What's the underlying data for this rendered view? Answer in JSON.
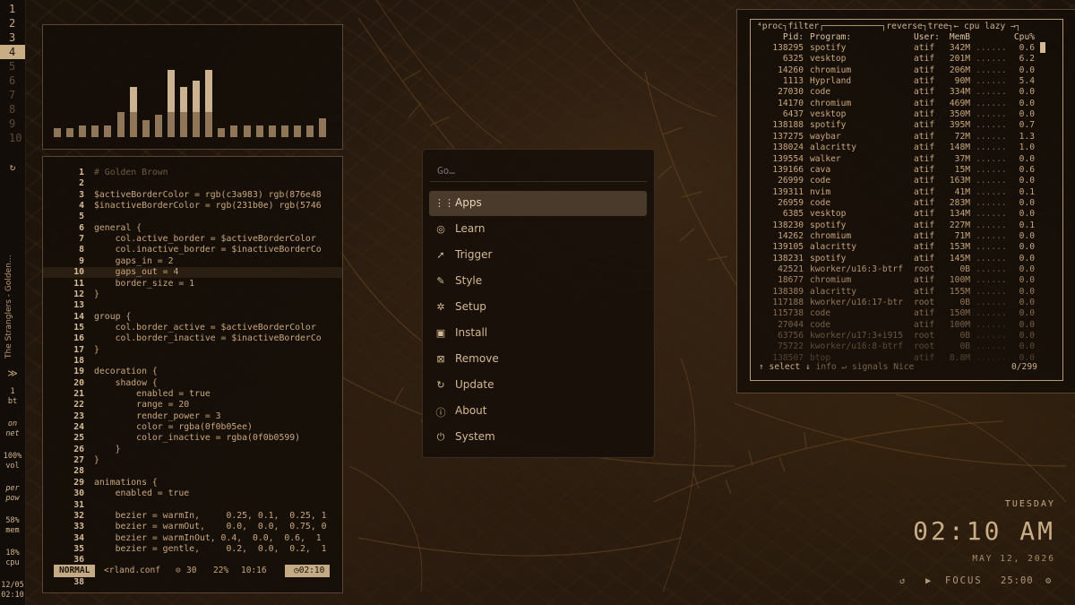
{
  "workspaces": [
    "1",
    "2",
    "3",
    "4",
    "5",
    "6",
    "7",
    "8",
    "9",
    "10"
  ],
  "active_workspace": "4",
  "sidebar": {
    "now_playing": "The Stranglers - Golden…",
    "bluetooth": "1\nbt",
    "network": "on\nnet",
    "volume": "100%\nvol",
    "power": "per\npow",
    "memory": "58%\nmem",
    "cpu": "18%\ncpu",
    "date": "12/05",
    "time": "02:10"
  },
  "visualizer": {
    "levels": [
      0.08,
      0.08,
      0.1,
      0.1,
      0.1,
      0.22,
      0.45,
      0.15,
      0.2,
      0.6,
      0.45,
      0.5,
      0.6,
      0.05,
      0.1,
      0.1,
      0.1,
      0.1,
      0.1,
      0.1,
      0.1,
      0.17
    ]
  },
  "editor": {
    "lines": [
      {
        "n": "1",
        "t": "# Golden Brown",
        "cmt": true
      },
      {
        "n": "2",
        "t": ""
      },
      {
        "n": "3",
        "t": "$activeBorderColor = rgb(c3a983) rgb(876e48"
      },
      {
        "n": "4",
        "t": "$inactiveBorderColor = rgb(231b0e) rgb(5746"
      },
      {
        "n": "5",
        "t": ""
      },
      {
        "n": "6",
        "t": "general {"
      },
      {
        "n": "7",
        "t": "    col.active_border = $activeBorderColor"
      },
      {
        "n": "8",
        "t": "    col.inactive_border = $inactiveBorderCo"
      },
      {
        "n": "9",
        "t": "    gaps_in = 2"
      },
      {
        "n": "10",
        "t": "    gaps_out = 4",
        "current": true
      },
      {
        "n": "11",
        "t": "    border_size = 1"
      },
      {
        "n": "12",
        "t": "}"
      },
      {
        "n": "13",
        "t": ""
      },
      {
        "n": "14",
        "t": "group {"
      },
      {
        "n": "15",
        "t": "    col.border_active = $activeBorderColor"
      },
      {
        "n": "16",
        "t": "    col.border_inactive = $inactiveBorderCo"
      },
      {
        "n": "17",
        "t": "}"
      },
      {
        "n": "18",
        "t": ""
      },
      {
        "n": "19",
        "t": "decoration {"
      },
      {
        "n": "20",
        "t": "    shadow {"
      },
      {
        "n": "21",
        "t": "        enabled = true"
      },
      {
        "n": "22",
        "t": "        range = 20"
      },
      {
        "n": "23",
        "t": "        render_power = 3"
      },
      {
        "n": "24",
        "t": "        color = rgba(0f0b05ee)"
      },
      {
        "n": "25",
        "t": "        color_inactive = rgba(0f0b0599)"
      },
      {
        "n": "26",
        "t": "    }"
      },
      {
        "n": "27",
        "t": "}"
      },
      {
        "n": "28",
        "t": ""
      },
      {
        "n": "29",
        "t": "animations {"
      },
      {
        "n": "30",
        "t": "    enabled = true"
      },
      {
        "n": "31",
        "t": ""
      },
      {
        "n": "32",
        "t": "    bezier = warmIn,     0.25, 0.1,  0.25, 1"
      },
      {
        "n": "33",
        "t": "    bezier = warmOut,    0.0,  0.0,  0.75, 0"
      },
      {
        "n": "34",
        "t": "    bezier = warmInOut, 0.4,  0.0,  0.6,  1"
      },
      {
        "n": "35",
        "t": "    bezier = gentle,     0.2,  0.0,  0.2,  1"
      },
      {
        "n": "36",
        "t": ""
      },
      {
        "n": "37",
        "t": ""
      },
      {
        "n": "38",
        "t": ""
      }
    ],
    "status": {
      "mode": "NORMAL",
      "file": "<rland.conf",
      "count": "30",
      "percent": "22%",
      "position": "10:16",
      "time": "02:10"
    }
  },
  "launcher": {
    "placeholder": "Go…",
    "items": [
      {
        "icon": "⋮⋮",
        "label": "Apps",
        "selected": true,
        "name": "apps"
      },
      {
        "icon": "◎",
        "label": "Learn",
        "name": "learn"
      },
      {
        "icon": "➚",
        "label": "Trigger",
        "name": "trigger"
      },
      {
        "icon": "✎",
        "label": "Style",
        "name": "style"
      },
      {
        "icon": "✲",
        "label": "Setup",
        "name": "setup"
      },
      {
        "icon": "▣",
        "label": "Install",
        "name": "install"
      },
      {
        "icon": "⊠",
        "label": "Remove",
        "name": "remove"
      },
      {
        "icon": "↻",
        "label": "Update",
        "name": "update"
      },
      {
        "icon": "ⓘ",
        "label": "About",
        "name": "about"
      },
      {
        "icon": "⏻",
        "label": "System",
        "name": "system"
      }
    ]
  },
  "btop": {
    "header": "⁴proc┐filter┌───────────┐reverse┐tree┐← cpu lazy →┐",
    "columns": {
      "pid": "Pid:",
      "program": "Program:",
      "user": "User:",
      "mem": "MemB",
      "cpu": "Cpu%"
    },
    "processes": [
      [
        "138295",
        "spotify",
        "atif",
        "342M",
        "0.6"
      ],
      [
        "6325",
        "vesktop",
        "atif",
        "201M",
        "6.2"
      ],
      [
        "14260",
        "chromium",
        "atif",
        "206M",
        "0.0"
      ],
      [
        "1113",
        "Hyprland",
        "atif",
        "90M",
        "5.4"
      ],
      [
        "27030",
        "code",
        "atif",
        "334M",
        "0.0"
      ],
      [
        "14170",
        "chromium",
        "atif",
        "469M",
        "0.0"
      ],
      [
        "6437",
        "vesktop",
        "atif",
        "350M",
        "0.0"
      ],
      [
        "138188",
        "spotify",
        "atif",
        "395M",
        "0.7"
      ],
      [
        "137275",
        "waybar",
        "atif",
        "72M",
        "1.3"
      ],
      [
        "138024",
        "alacritty",
        "atif",
        "148M",
        "1.0"
      ],
      [
        "139554",
        "walker",
        "atif",
        "37M",
        "0.0"
      ],
      [
        "139166",
        "cava",
        "atif",
        "15M",
        "0.6"
      ],
      [
        "26999",
        "code",
        "atif",
        "163M",
        "0.0"
      ],
      [
        "139311",
        "nvim",
        "atif",
        "41M",
        "0.1"
      ],
      [
        "26959",
        "code",
        "atif",
        "283M",
        "0.0"
      ],
      [
        "6385",
        "vesktop",
        "atif",
        "134M",
        "0.0"
      ],
      [
        "138230",
        "spotify",
        "atif",
        "227M",
        "0.1"
      ],
      [
        "14262",
        "chromium",
        "atif",
        "71M",
        "0.0"
      ],
      [
        "139105",
        "alacritty",
        "atif",
        "153M",
        "0.0"
      ],
      [
        "138231",
        "spotify",
        "atif",
        "145M",
        "0.0"
      ],
      [
        "42521",
        "kworker/u16:3-btrf",
        "root",
        "0B",
        "0.0"
      ],
      [
        "18677",
        "chromium",
        "atif",
        "100M",
        "0.0"
      ],
      [
        "138389",
        "alacritty",
        "atif",
        "155M",
        "0.0"
      ],
      [
        "117188",
        "kworker/u16:17-btr",
        "root",
        "0B",
        "0.0"
      ],
      [
        "115738",
        "code",
        "atif",
        "150M",
        "0.0"
      ],
      [
        "27044",
        "code",
        "atif",
        "100M",
        "0.0"
      ],
      [
        "63756",
        "kworker/u17:3+i915",
        "root",
        "0B",
        "0.0"
      ],
      [
        "75722",
        "kworker/u16:8-btrf",
        "root",
        "0B",
        "0.0"
      ],
      [
        "138507",
        "btop",
        "atif",
        "8.8M",
        "0.0"
      ]
    ],
    "footer_select": "↑ select ↓",
    "footer_info": "info ↵",
    "footer_signals": "signals",
    "footer_nice": "Nice",
    "footer_count": "0/299"
  },
  "clock": {
    "day": "TUESDAY",
    "time": "02:10 AM",
    "date": "MAY 12, 2026"
  },
  "focus": {
    "label": "FOCUS",
    "timer": "25:00"
  },
  "colors": {
    "accent": "#c8ad85",
    "background": "#1c130b",
    "panel_border": "#5a4633"
  }
}
